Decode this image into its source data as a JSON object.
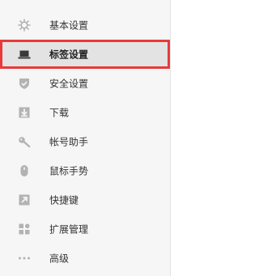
{
  "sidebar": {
    "items": [
      {
        "label": "基本设置",
        "icon": "gear-icon"
      },
      {
        "label": "标签设置",
        "icon": "laptop-icon",
        "selected": true
      },
      {
        "label": "安全设置",
        "icon": "shield-icon"
      },
      {
        "label": "下载",
        "icon": "download-icon"
      },
      {
        "label": "帐号助手",
        "icon": "key-icon"
      },
      {
        "label": "鼠标手势",
        "icon": "mouse-icon"
      },
      {
        "label": "快捷键",
        "icon": "shortcut-icon"
      },
      {
        "label": "扩展管理",
        "icon": "extensions-icon"
      },
      {
        "label": "高级",
        "icon": "more-icon"
      }
    ]
  },
  "colors": {
    "sidebar_bg": "#f6f6f6",
    "selected_bg": "#e3e3e3",
    "highlight_border": "#e83a3a",
    "icon_color": "#b3b3b3",
    "active_icon_color": "#3a3a3a"
  }
}
